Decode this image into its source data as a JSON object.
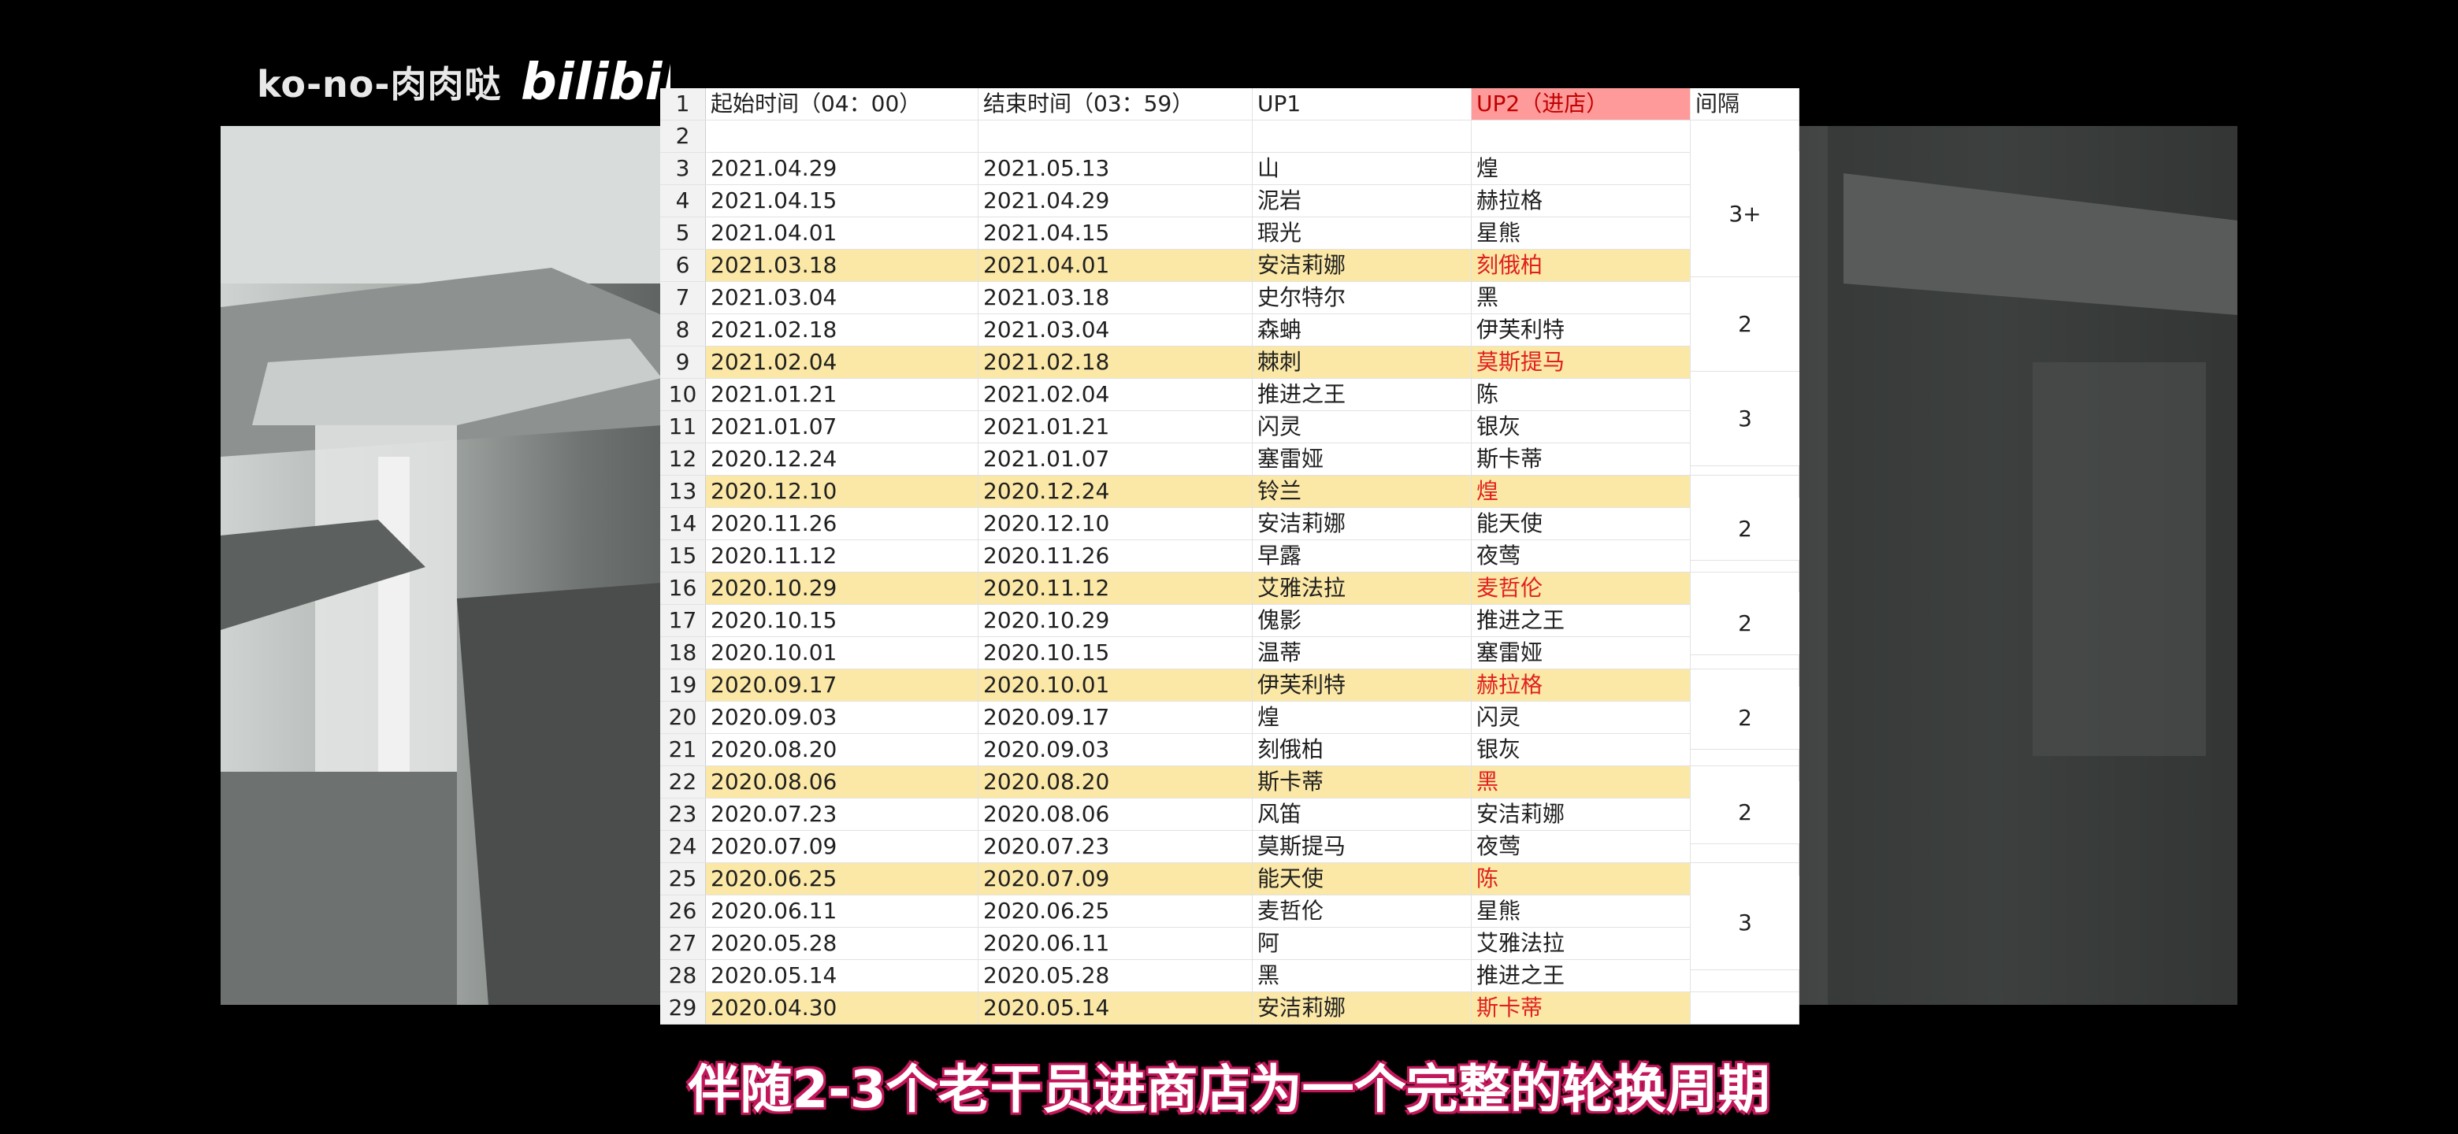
{
  "watermark": {
    "author": "ko-no-肉肉哒",
    "logo": "bilibili"
  },
  "sheet": {
    "header": {
      "row": "1",
      "start": "起始时间（04：00）",
      "end": "结束时间（03：59）",
      "up1": "UP1",
      "up2": "UP2（进店）",
      "gap": "间隔"
    },
    "empty_row": "2",
    "rows": [
      {
        "n": "3",
        "start": "2021.04.29",
        "end": "2021.05.13",
        "up1": "山",
        "up2": "煌",
        "hl": false
      },
      {
        "n": "4",
        "start": "2021.04.15",
        "end": "2021.04.29",
        "up1": "泥岩",
        "up2": "赫拉格",
        "hl": false
      },
      {
        "n": "5",
        "start": "2021.04.01",
        "end": "2021.04.15",
        "up1": "瑕光",
        "up2": "星熊",
        "hl": false
      },
      {
        "n": "6",
        "start": "2021.03.18",
        "end": "2021.04.01",
        "up1": "安洁莉娜",
        "up2": "刻俄柏",
        "hl": true
      },
      {
        "n": "7",
        "start": "2021.03.04",
        "end": "2021.03.18",
        "up1": "史尔特尔",
        "up2": "黑",
        "hl": false
      },
      {
        "n": "8",
        "start": "2021.02.18",
        "end": "2021.03.04",
        "up1": "森蚺",
        "up2": "伊芙利特",
        "hl": false
      },
      {
        "n": "9",
        "start": "2021.02.04",
        "end": "2021.02.18",
        "up1": "棘刺",
        "up2": "莫斯提马",
        "hl": true
      },
      {
        "n": "10",
        "start": "2021.01.21",
        "end": "2021.02.04",
        "up1": "推进之王",
        "up2": "陈",
        "hl": false
      },
      {
        "n": "11",
        "start": "2021.01.07",
        "end": "2021.01.21",
        "up1": "闪灵",
        "up2": "银灰",
        "hl": false
      },
      {
        "n": "12",
        "start": "2020.12.24",
        "end": "2021.01.07",
        "up1": "塞雷娅",
        "up2": "斯卡蒂",
        "hl": false
      },
      {
        "n": "13",
        "start": "2020.12.10",
        "end": "2020.12.24",
        "up1": "铃兰",
        "up2": "煌",
        "hl": true
      },
      {
        "n": "14",
        "start": "2020.11.26",
        "end": "2020.12.10",
        "up1": "安洁莉娜",
        "up2": "能天使",
        "hl": false
      },
      {
        "n": "15",
        "start": "2020.11.12",
        "end": "2020.11.26",
        "up1": "早露",
        "up2": "夜莺",
        "hl": false
      },
      {
        "n": "16",
        "start": "2020.10.29",
        "end": "2020.11.12",
        "up1": "艾雅法拉",
        "up2": "麦哲伦",
        "hl": true
      },
      {
        "n": "17",
        "start": "2020.10.15",
        "end": "2020.10.29",
        "up1": "傀影",
        "up2": "推进之王",
        "hl": false
      },
      {
        "n": "18",
        "start": "2020.10.01",
        "end": "2020.10.15",
        "up1": "温蒂",
        "up2": "塞雷娅",
        "hl": false
      },
      {
        "n": "19",
        "start": "2020.09.17",
        "end": "2020.10.01",
        "up1": "伊芙利特",
        "up2": "赫拉格",
        "hl": true
      },
      {
        "n": "20",
        "start": "2020.09.03",
        "end": "2020.09.17",
        "up1": "煌",
        "up2": "闪灵",
        "hl": false
      },
      {
        "n": "21",
        "start": "2020.08.20",
        "end": "2020.09.03",
        "up1": "刻俄柏",
        "up2": "银灰",
        "hl": false
      },
      {
        "n": "22",
        "start": "2020.08.06",
        "end": "2020.08.20",
        "up1": "斯卡蒂",
        "up2": "黑",
        "hl": true
      },
      {
        "n": "23",
        "start": "2020.07.23",
        "end": "2020.08.06",
        "up1": "风笛",
        "up2": "安洁莉娜",
        "hl": false
      },
      {
        "n": "24",
        "start": "2020.07.09",
        "end": "2020.07.23",
        "up1": "莫斯提马",
        "up2": "夜莺",
        "hl": false
      },
      {
        "n": "25",
        "start": "2020.06.25",
        "end": "2020.07.09",
        "up1": "能天使",
        "up2": "陈",
        "hl": true
      },
      {
        "n": "26",
        "start": "2020.06.11",
        "end": "2020.06.25",
        "up1": "麦哲伦",
        "up2": "星熊",
        "hl": false
      },
      {
        "n": "27",
        "start": "2020.05.28",
        "end": "2020.06.11",
        "up1": "阿",
        "up2": "艾雅法拉",
        "hl": false
      },
      {
        "n": "28",
        "start": "2020.05.14",
        "end": "2020.05.28",
        "up1": "黑",
        "up2": "推进之王",
        "hl": false
      },
      {
        "n": "29",
        "start": "2020.04.30",
        "end": "2020.05.14",
        "up1": "安洁莉娜",
        "up2": "斯卡蒂",
        "hl": true
      }
    ],
    "gaps": [
      "3+",
      "2",
      "3",
      "2",
      "2",
      "2",
      "2",
      "3"
    ]
  },
  "subtitle": "伴随2-3个老干员进商店为一个完整的轮换周期"
}
